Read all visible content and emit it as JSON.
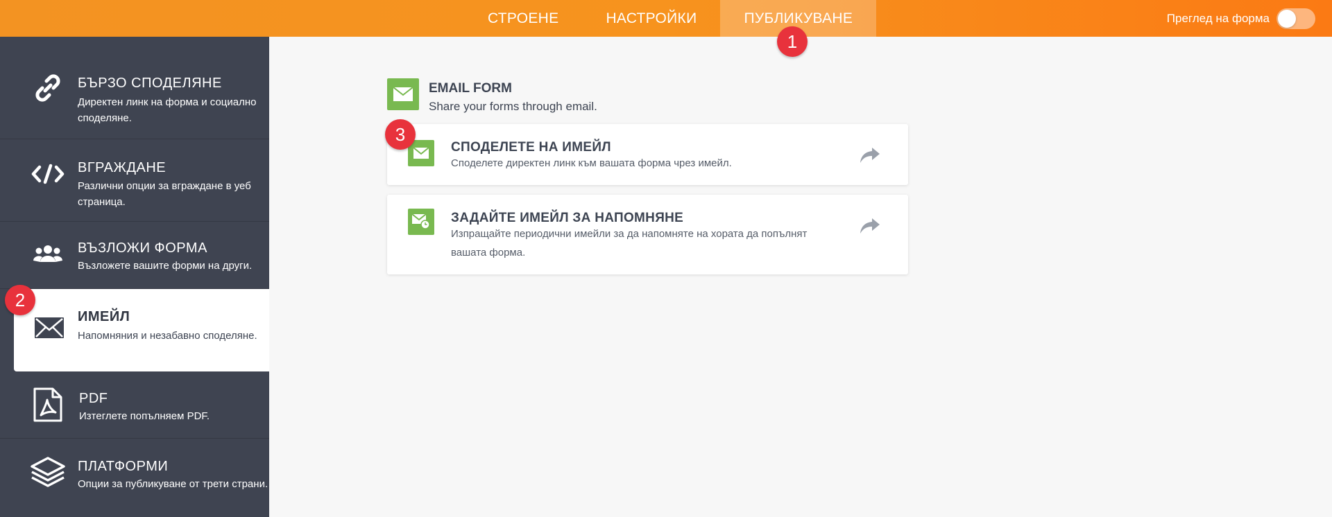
{
  "header": {
    "tabs": [
      {
        "label": "СТРОЕНЕ",
        "active": false
      },
      {
        "label": "НАСТРОЙКИ",
        "active": false
      },
      {
        "label": "ПУБЛИКУВАНЕ",
        "active": true
      }
    ],
    "preview_label": "Преглед на форма",
    "preview_toggle": "off"
  },
  "sidebar": {
    "items": [
      {
        "icon": "link-icon",
        "title": "БЪРЗО СПОДЕЛЯНЕ",
        "desc": "Директен линк на форма и социално споделяне."
      },
      {
        "icon": "code-icon",
        "title": "ВГРАЖДАНЕ",
        "desc": "Различни опции за вграждане в уеб страница."
      },
      {
        "icon": "users-icon",
        "title": "ВЪЗЛОЖИ ФОРМА",
        "desc": "Възложете вашите форми на други."
      },
      {
        "icon": "envelope-icon",
        "title": "ИМЕЙЛ",
        "desc": "Напомняния и незабавно споделяне.",
        "active": true
      },
      {
        "icon": "pdf-icon",
        "title": "PDF",
        "desc": "Изтеглете попълняем PDF."
      },
      {
        "icon": "layers-icon",
        "title": "ПЛАТФОРМИ",
        "desc": "Опции за публикуване от трети страни."
      }
    ]
  },
  "main": {
    "section_title": "EMAIL FORM",
    "section_subtitle": "Share your forms through email.",
    "cards": [
      {
        "icon": "mail-icon",
        "title": "СПОДЕЛЕТЕ НА ИМЕЙЛ",
        "desc": "Споделете директен линк към вашата форма чрез имейл."
      },
      {
        "icon": "mail-clock-icon",
        "title": "ЗАДАЙТЕ ИМЕЙЛ ЗА НАПОМНЯНЕ",
        "desc": "Изпращайте периодични имейли за да напомняте на хората да попълнят вашата форма."
      }
    ]
  },
  "badges": [
    "1",
    "2",
    "3"
  ],
  "colors": {
    "accent": "#f7931e",
    "sidebar": "#3f4451",
    "green": "#79b950",
    "badge": "#e8323c"
  }
}
